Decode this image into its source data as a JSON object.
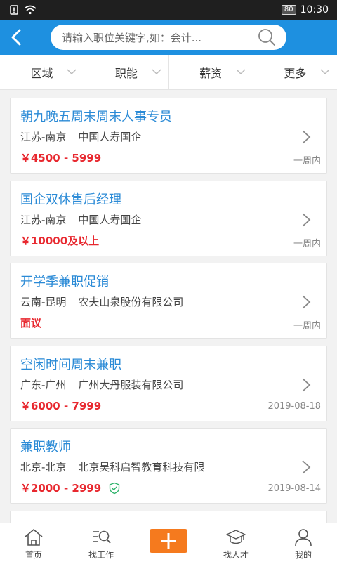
{
  "status": {
    "battery": "80",
    "time": "10:30"
  },
  "search": {
    "placeholder": "请输入职位关键字,如：会计..."
  },
  "filters": [
    {
      "label": "区域"
    },
    {
      "label": "职能"
    },
    {
      "label": "薪资"
    },
    {
      "label": "更多"
    }
  ],
  "jobs": [
    {
      "title": "朝九晚五周末周末人事专员",
      "location": "江苏-南京",
      "company": "中国人寿国企",
      "salary": "￥4500 - 5999",
      "date": "一周内"
    },
    {
      "title": "国企双休售后经理",
      "location": "江苏-南京",
      "company": "中国人寿国企",
      "salary": "￥10000及以上",
      "date": "一周内"
    },
    {
      "title": "开学季兼职促销",
      "location": "云南-昆明",
      "company": "农夫山泉股份有限公司",
      "salary": "面议",
      "date": "一周内"
    },
    {
      "title": "空闲时间周末兼职",
      "location": "广东-广州",
      "company": "广州大丹服装有限公司",
      "salary": "￥6000 - 7999",
      "date": "2019-08-18"
    },
    {
      "title": "兼职教师",
      "location": "北京-北京",
      "company": "北京昊科启智教育科技有限",
      "salary": "￥2000 - 2999",
      "date": "2019-08-14"
    }
  ],
  "tabs": [
    {
      "label": "首页"
    },
    {
      "label": "找工作"
    },
    {
      "label": ""
    },
    {
      "label": "找人才"
    },
    {
      "label": "我的"
    }
  ],
  "colors": {
    "header": "#1e90e0",
    "title": "#2a8ad6",
    "salary": "#e8282f",
    "plus": "#f57a1e"
  }
}
